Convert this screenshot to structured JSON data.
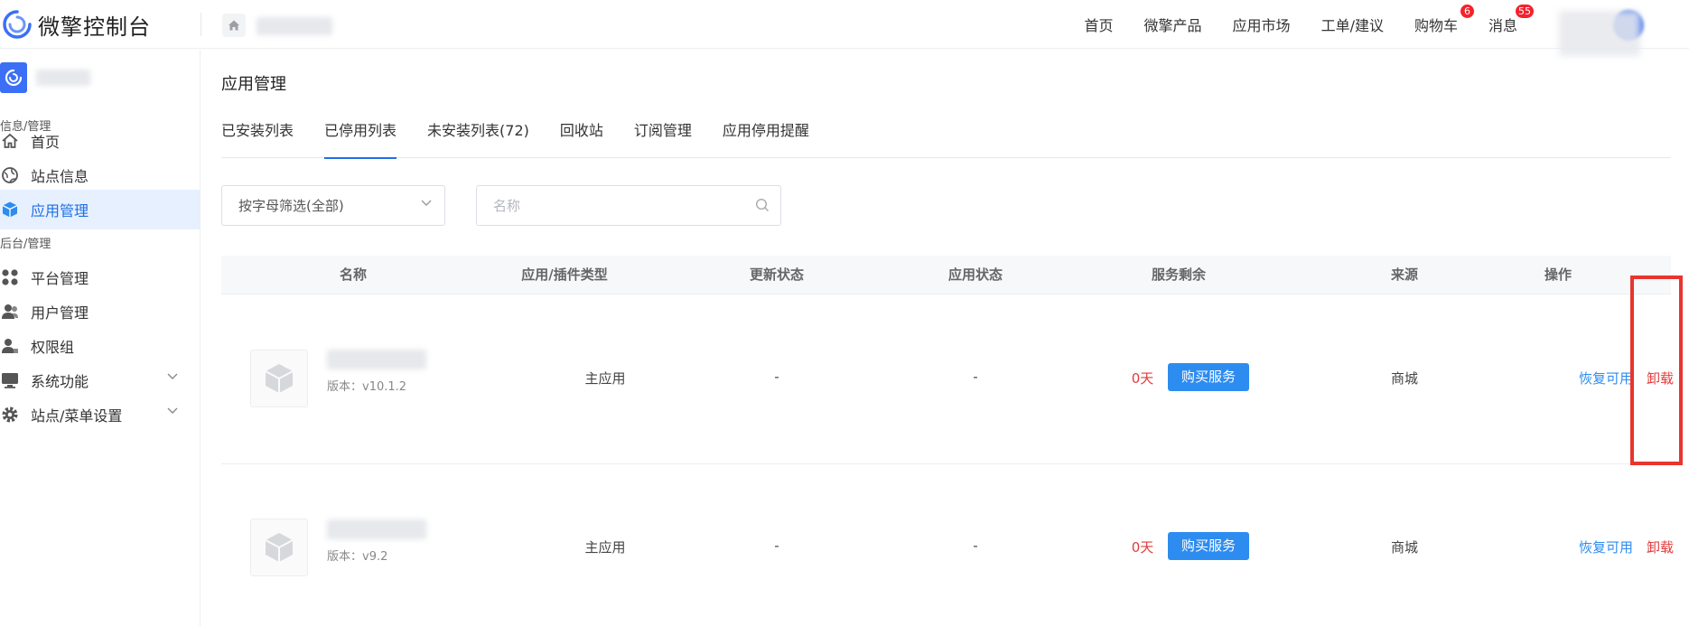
{
  "header": {
    "logo_text": "微擎控制台",
    "nav": [
      {
        "label": "首页"
      },
      {
        "label": "微擎产品"
      },
      {
        "label": "应用市场"
      },
      {
        "label": "工单/建议"
      },
      {
        "label": "购物车",
        "badge": "6"
      },
      {
        "label": "消息",
        "badge": "55"
      }
    ]
  },
  "sidebar": {
    "group1": "信息/管理",
    "items1": [
      {
        "label": "首页",
        "icon": "home-icon"
      },
      {
        "label": "站点信息",
        "icon": "globe-icon"
      },
      {
        "label": "应用管理",
        "icon": "cube-icon",
        "active": true
      }
    ],
    "group2": "后台/管理",
    "items2": [
      {
        "label": "平台管理",
        "icon": "grid-icon"
      },
      {
        "label": "用户管理",
        "icon": "users-icon"
      },
      {
        "label": "权限组",
        "icon": "user-key-icon"
      },
      {
        "label": "系统功能",
        "icon": "monitor-icon",
        "expandable": true
      },
      {
        "label": "站点/菜单设置",
        "icon": "gear-icon",
        "expandable": true
      }
    ]
  },
  "main": {
    "title": "应用管理",
    "tabs": [
      {
        "label": "已安装列表"
      },
      {
        "label": "已停用列表",
        "active": true
      },
      {
        "label": "未安装列表(72)"
      },
      {
        "label": "回收站"
      },
      {
        "label": "订阅管理"
      },
      {
        "label": "应用停用提醒"
      }
    ],
    "filter": {
      "selected": "按字母筛选(全部)"
    },
    "search": {
      "placeholder": "名称",
      "value": ""
    },
    "table": {
      "columns": [
        "名称",
        "应用/插件类型",
        "更新状态",
        "应用状态",
        "服务剩余",
        "来源",
        "操作"
      ],
      "rows": [
        {
          "version": "版本：v10.1.2",
          "type": "主应用",
          "update_status": "-",
          "app_status": "-",
          "remaining": "0天",
          "buy_label": "购买服务",
          "source": "商城",
          "restore_label": "恢复可用",
          "uninstall_label": "卸载"
        },
        {
          "version": "版本：v9.2",
          "type": "主应用",
          "update_status": "-",
          "app_status": "-",
          "remaining": "0天",
          "buy_label": "购买服务",
          "source": "商城",
          "restore_label": "恢复可用",
          "uninstall_label": "卸载"
        }
      ]
    }
  },
  "colors": {
    "primary": "#2d8cf0",
    "active_bg": "#e6f0ff",
    "danger": "#e23b3b",
    "highlight": "#e8352f"
  }
}
